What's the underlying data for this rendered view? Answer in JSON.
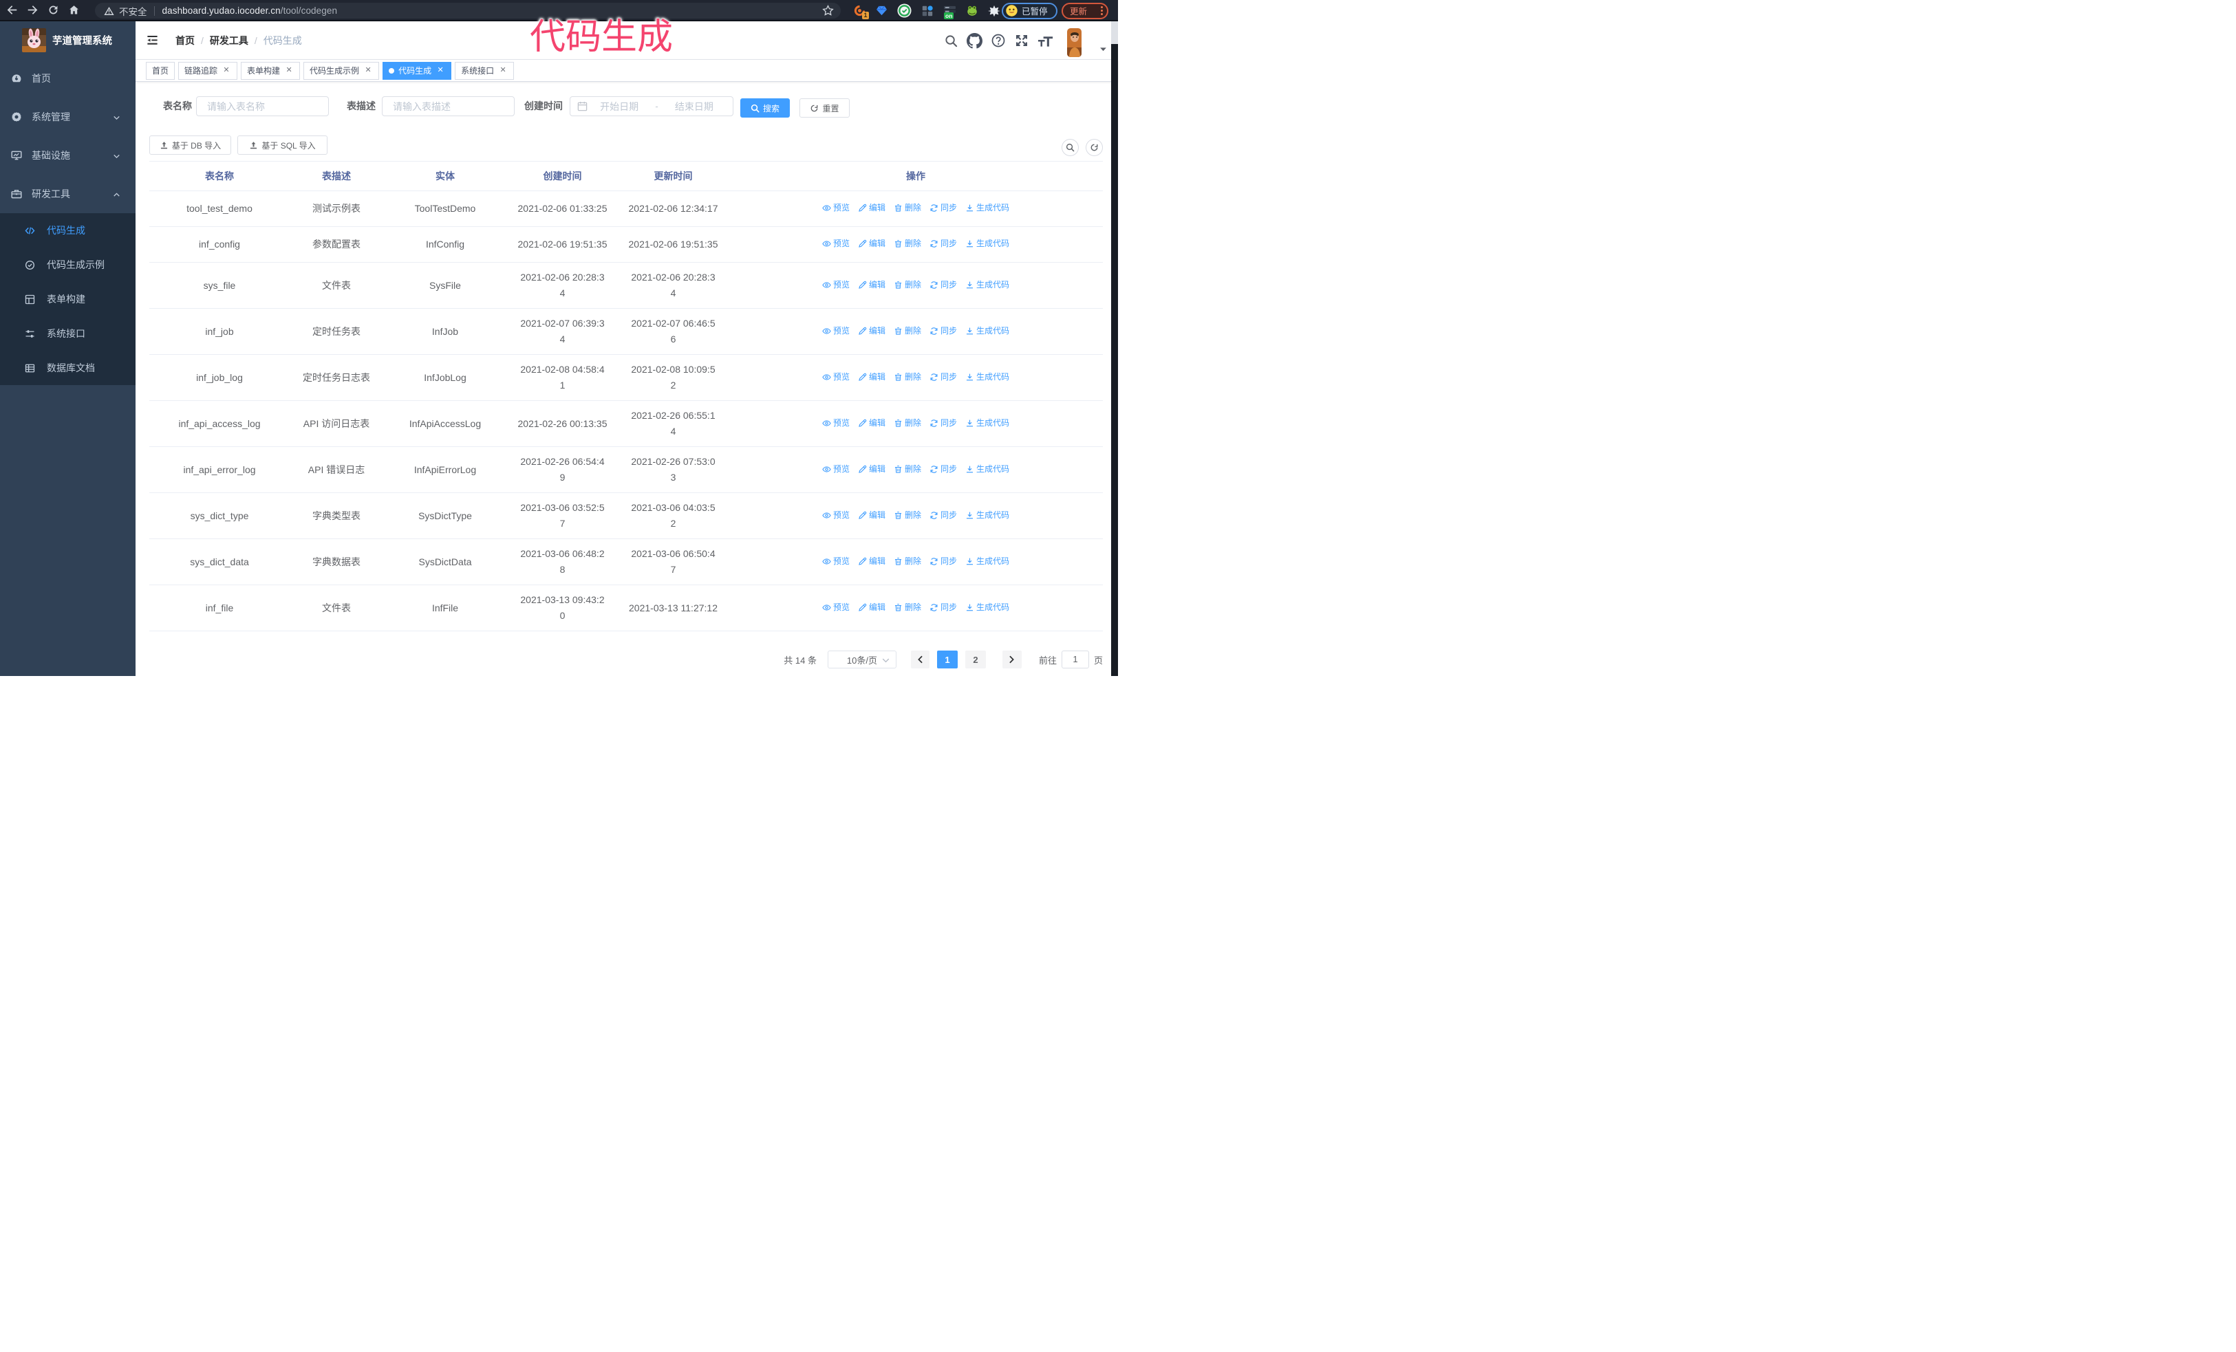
{
  "annotation": {
    "text": "代码生成",
    "color": "#f5456f"
  },
  "browser": {
    "security_label": "不安全",
    "url_host": "dashboard.yudao.iocoder.cn",
    "url_path": "/tool/codegen",
    "extension_badge": "1",
    "extension_on_badge": "on",
    "paused_label": "已暂停",
    "update_label": "更新"
  },
  "sidebar": {
    "logo_title": "芋道管理系统",
    "items": [
      {
        "label": "首页",
        "icon": "dashboard-icon"
      },
      {
        "label": "系统管理",
        "icon": "gear-icon",
        "chevron": "down"
      },
      {
        "label": "基础设施",
        "icon": "infra-icon",
        "chevron": "down"
      },
      {
        "label": "研发工具",
        "icon": "tools-icon",
        "chevron": "up",
        "children": [
          {
            "label": "代码生成",
            "icon": "code-icon",
            "active": true
          },
          {
            "label": "代码生成示例",
            "icon": "example-icon"
          },
          {
            "label": "表单构建",
            "icon": "form-build-icon"
          },
          {
            "label": "系统接口",
            "icon": "api-icon"
          },
          {
            "label": "数据库文档",
            "icon": "db-doc-icon"
          }
        ]
      }
    ]
  },
  "navbar": {
    "breadcrumb": [
      "首页",
      "研发工具",
      "代码生成"
    ],
    "breadcrumb_separator": "/"
  },
  "tabs": [
    {
      "label": "首页",
      "closable": false,
      "active": false
    },
    {
      "label": "链路追踪",
      "closable": true,
      "active": false
    },
    {
      "label": "表单构建",
      "closable": true,
      "active": false
    },
    {
      "label": "代码生成示例",
      "closable": true,
      "active": false
    },
    {
      "label": "代码生成",
      "closable": true,
      "active": true
    },
    {
      "label": "系统接口",
      "closable": true,
      "active": false
    }
  ],
  "filters": {
    "table_name_label": "表名称",
    "table_name_placeholder": "请输入表名称",
    "table_desc_label": "表描述",
    "table_desc_placeholder": "请输入表描述",
    "create_time_label": "创建时间",
    "date_start_placeholder": "开始日期",
    "date_separator": "-",
    "date_end_placeholder": "结束日期",
    "search_label": "搜索",
    "reset_label": "重置"
  },
  "toolbar": {
    "import_db_label": "基于 DB 导入",
    "import_sql_label": "基于 SQL 导入"
  },
  "table": {
    "columns": [
      "表名称",
      "表描述",
      "实体",
      "创建时间",
      "更新时间",
      "操作"
    ],
    "actions": [
      {
        "label": "预览",
        "icon": "eye-icon"
      },
      {
        "label": "编辑",
        "icon": "edit-icon"
      },
      {
        "label": "删除",
        "icon": "delete-icon"
      },
      {
        "label": "同步",
        "icon": "sync-icon"
      },
      {
        "label": "生成代码",
        "icon": "download-icon"
      }
    ],
    "rows": [
      {
        "name": "tool_test_demo",
        "desc": "测试示例表",
        "entity": "ToolTestDemo",
        "created": [
          "2021-02-06 01:33:25"
        ],
        "updated": [
          "2021-02-06 12:34:17"
        ]
      },
      {
        "name": "inf_config",
        "desc": "参数配置表",
        "entity": "InfConfig",
        "created": [
          "2021-02-06 19:51:35"
        ],
        "updated": [
          "2021-02-06 19:51:35"
        ]
      },
      {
        "name": "sys_file",
        "desc": "文件表",
        "entity": "SysFile",
        "created": [
          "2021-02-06 20:28:3",
          "4"
        ],
        "updated": [
          "2021-02-06 20:28:3",
          "4"
        ]
      },
      {
        "name": "inf_job",
        "desc": "定时任务表",
        "entity": "InfJob",
        "created": [
          "2021-02-07 06:39:3",
          "4"
        ],
        "updated": [
          "2021-02-07 06:46:5",
          "6"
        ]
      },
      {
        "name": "inf_job_log",
        "desc": "定时任务日志表",
        "entity": "InfJobLog",
        "created": [
          "2021-02-08 04:58:4",
          "1"
        ],
        "updated": [
          "2021-02-08 10:09:5",
          "2"
        ]
      },
      {
        "name": "inf_api_access_log",
        "desc": "API 访问日志表",
        "entity": "InfApiAccessLog",
        "created": [
          "2021-02-26 00:13:35"
        ],
        "updated": [
          "2021-02-26 06:55:1",
          "4"
        ]
      },
      {
        "name": "inf_api_error_log",
        "desc": "API 错误日志",
        "entity": "InfApiErrorLog",
        "created": [
          "2021-02-26 06:54:4",
          "9"
        ],
        "updated": [
          "2021-02-26 07:53:0",
          "3"
        ]
      },
      {
        "name": "sys_dict_type",
        "desc": "字典类型表",
        "entity": "SysDictType",
        "created": [
          "2021-03-06 03:52:5",
          "7"
        ],
        "updated": [
          "2021-03-06 04:03:5",
          "2"
        ]
      },
      {
        "name": "sys_dict_data",
        "desc": "字典数据表",
        "entity": "SysDictData",
        "created": [
          "2021-03-06 06:48:2",
          "8"
        ],
        "updated": [
          "2021-03-06 06:50:4",
          "7"
        ]
      },
      {
        "name": "inf_file",
        "desc": "文件表",
        "entity": "InfFile",
        "created": [
          "2021-03-13 09:43:2",
          "0"
        ],
        "updated": [
          "2021-03-13 11:27:12"
        ]
      }
    ]
  },
  "pagination": {
    "total_label": "共 14 条",
    "page_size_label": "10条/页",
    "pages": [
      "1",
      "2"
    ],
    "active_page": "1",
    "goto_label": "前往",
    "goto_value": "1",
    "page_unit_label": "页"
  },
  "colors": {
    "accent": "#409eff",
    "sidebar_bg": "#304156",
    "submenu_bg": "#1f2d3d",
    "sidebar_text": "#bfcbd9",
    "annotation_pink": "#f5456f",
    "table_header_text": "#5a6e9c"
  }
}
